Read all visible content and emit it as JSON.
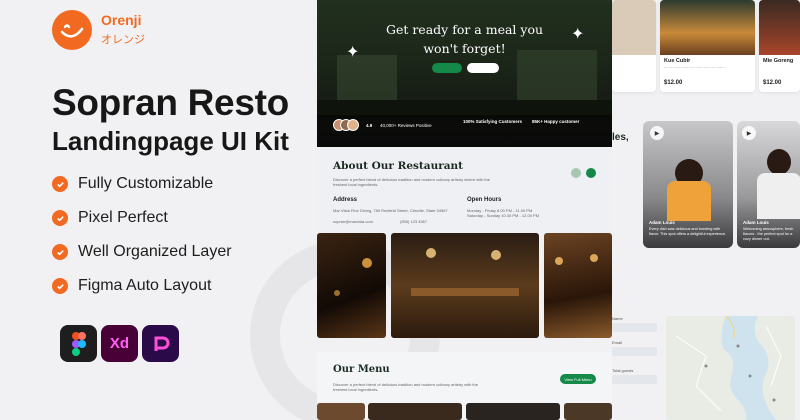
{
  "brand": {
    "name": "Orenji",
    "name_jp": "オレンジ",
    "accent": "#f26a21"
  },
  "product": {
    "title_line1": "Sopran Resto",
    "title_line2": "Landingpage UI Kit"
  },
  "features": [
    "Fully Customizable",
    "Pixel Perfect",
    "Well Organized Layer",
    "Figma Auto Layout"
  ],
  "tools": [
    {
      "icon": "figma-icon"
    },
    {
      "label": "Xd",
      "icon": "adobe-xd-icon"
    },
    {
      "icon": "penpot-icon"
    }
  ],
  "hero": {
    "title_line1": "Get ready for a meal you",
    "title_line2": "won't forget!",
    "stats": {
      "rating": "4.9",
      "reviews": "40,000+ Reviews Positive",
      "satisfying": "100% Satisfying Customers",
      "happy": "85K+ Happy customer"
    }
  },
  "about": {
    "title": "About Our Restaurant",
    "description_line1": "Discover a perfect blend of delicious tradition and modern culinary artistry where with the",
    "description_line2": "freshest local ingredients.",
    "address_label": "Address",
    "address_value": "Mar Vista Fine Dining, 789 Redfield Street, Citnville, State 34567",
    "hours_label": "Open Hours",
    "hours_line1": "Monday - Friday 8.00 PM - 11.00 PM",
    "hours_line2": "Saturday - Sunday 10.30 PM - 12.00 PM",
    "email": "sopran@marvista.com",
    "phone": "(555) 123 4567"
  },
  "menu": {
    "title": "Our Menu",
    "description_line1": "Discover a perfect blend of delicious tradition and modern culinary artistry with the",
    "description_line2": "freshest local ingredients.",
    "button": "View Full Menu"
  },
  "dishes": [
    {
      "name": "Kue Cubir",
      "price": "$12.00"
    },
    {
      "name": "Mie Goreng",
      "price": "$12.00"
    }
  ],
  "side_heading": "les,",
  "testimonials": [
    {
      "name": "Adam Louis",
      "quote": "Every dish was delicious and bursting with flavor. This spot offers a delightful experience."
    },
    {
      "name": "Adam Louis",
      "quote": "Welcoming atmosphere, fresh flavors - the perfect spot for a cozy dinner out."
    }
  ],
  "form": {
    "name_label": "Name",
    "email_label": "Email",
    "guests_label": "Total guests"
  }
}
